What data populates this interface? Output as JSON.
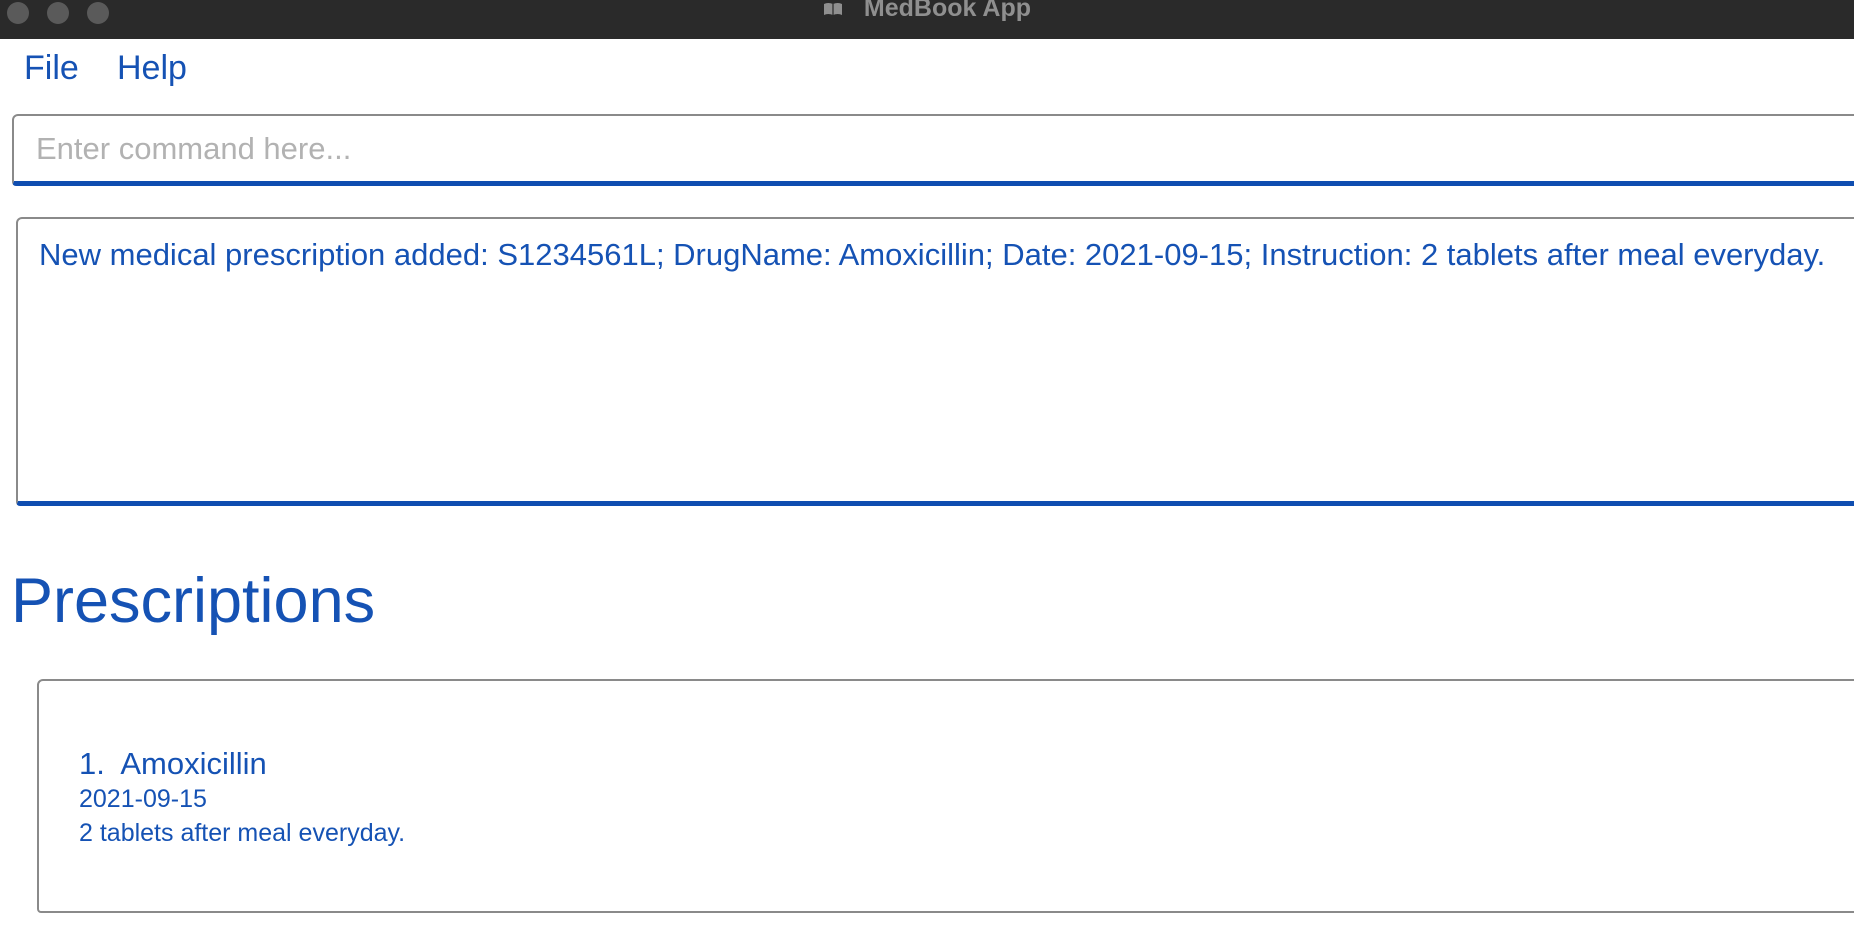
{
  "window": {
    "title": "MedBook App",
    "app_icon": "book-icon"
  },
  "menu": {
    "file_label": "File",
    "help_label": "Help"
  },
  "command": {
    "value": "",
    "placeholder": "Enter command here..."
  },
  "result": {
    "message": "New medical prescription added: S1234561L; DrugName: Amoxicillin; Date: 2021-09-15; Instruction: 2 tablets after meal everyday."
  },
  "prescriptions": {
    "heading": "Prescriptions",
    "items": [
      {
        "index": "1.",
        "drug_name": "Amoxicillin",
        "date": "2021-09-15",
        "instruction": "2 tablets after meal everyday."
      }
    ]
  },
  "colors": {
    "accent": "#1552b4",
    "titlebar": "#2a2a2a",
    "placeholder": "#b2b2b2"
  }
}
